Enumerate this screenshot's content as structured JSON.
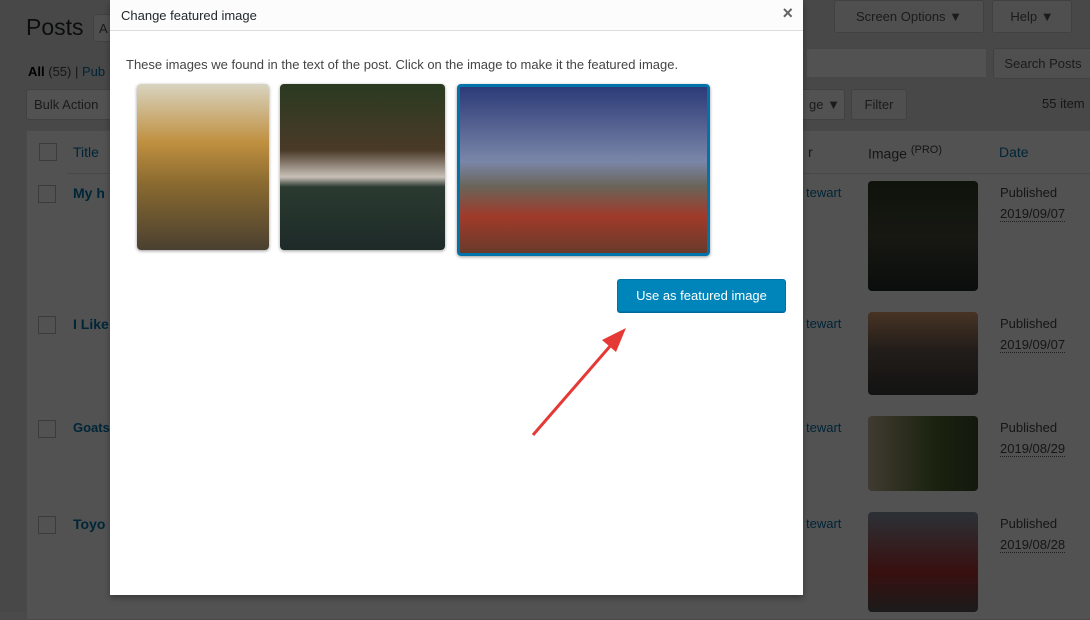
{
  "background": {
    "page_title": "Posts",
    "add_new": "A",
    "filters": {
      "all": "All",
      "all_count": "(55)",
      "sep": "|",
      "published": "Pub"
    },
    "screen_options": "Screen Options ▼",
    "help": "Help ▼",
    "search_button": "Search Posts",
    "bulk_actions": "Bulk Action",
    "image_filter": "ge ▼",
    "filter_button": "Filter",
    "items_count": "55 item",
    "columns": {
      "title": "Title",
      "author": "r",
      "image": "Image",
      "image_sup": "(PRO)",
      "date": "Date"
    },
    "rows": [
      {
        "title": "My h",
        "author": "tewart",
        "status": "Published",
        "date": "2019/09/07"
      },
      {
        "title": "I Like",
        "author": "tewart",
        "status": "Published",
        "date": "2019/09/07"
      },
      {
        "title": "Goats",
        "author": "tewart",
        "status": "Published",
        "date": "2019/08/29"
      },
      {
        "title": "Toyo",
        "author": "tewart",
        "status": "Published",
        "date": "2019/08/28"
      }
    ]
  },
  "modal": {
    "title": "Change featured image",
    "close_icon": "×",
    "description": "These images we found in the text of the post. Click on the image to make it the featured image.",
    "images": [
      "abandoned-house-in-autumn-field",
      "lakeside-house-in-forest",
      "stone-house-with-flowers"
    ],
    "selected_index": 2,
    "use_button": "Use as featured image"
  },
  "colors": {
    "accent": "#0085ba",
    "selected_border": "#0073aa",
    "arrow": "#e53935"
  }
}
